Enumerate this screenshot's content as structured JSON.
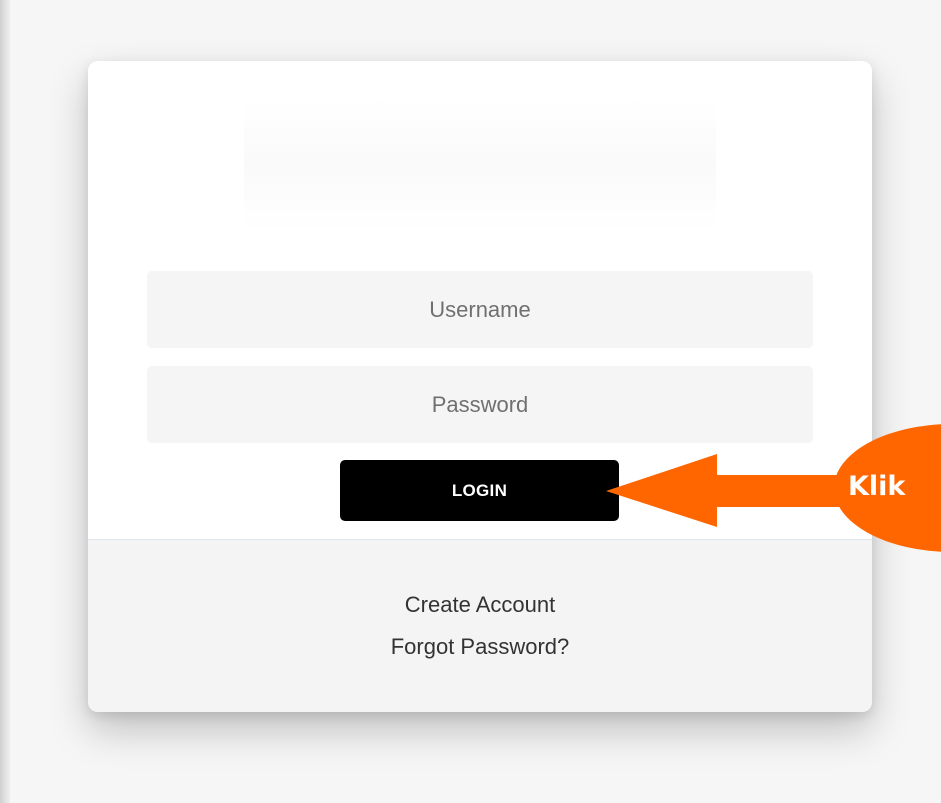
{
  "login_form": {
    "username_placeholder": "Username",
    "password_placeholder": "Password",
    "login_label": "LOGIN"
  },
  "footer": {
    "create_account": "Create Account",
    "forgot_password": "Forgot Password?"
  },
  "annotation": {
    "callout_text": "Klik",
    "arrow_color": "#ff6600"
  }
}
